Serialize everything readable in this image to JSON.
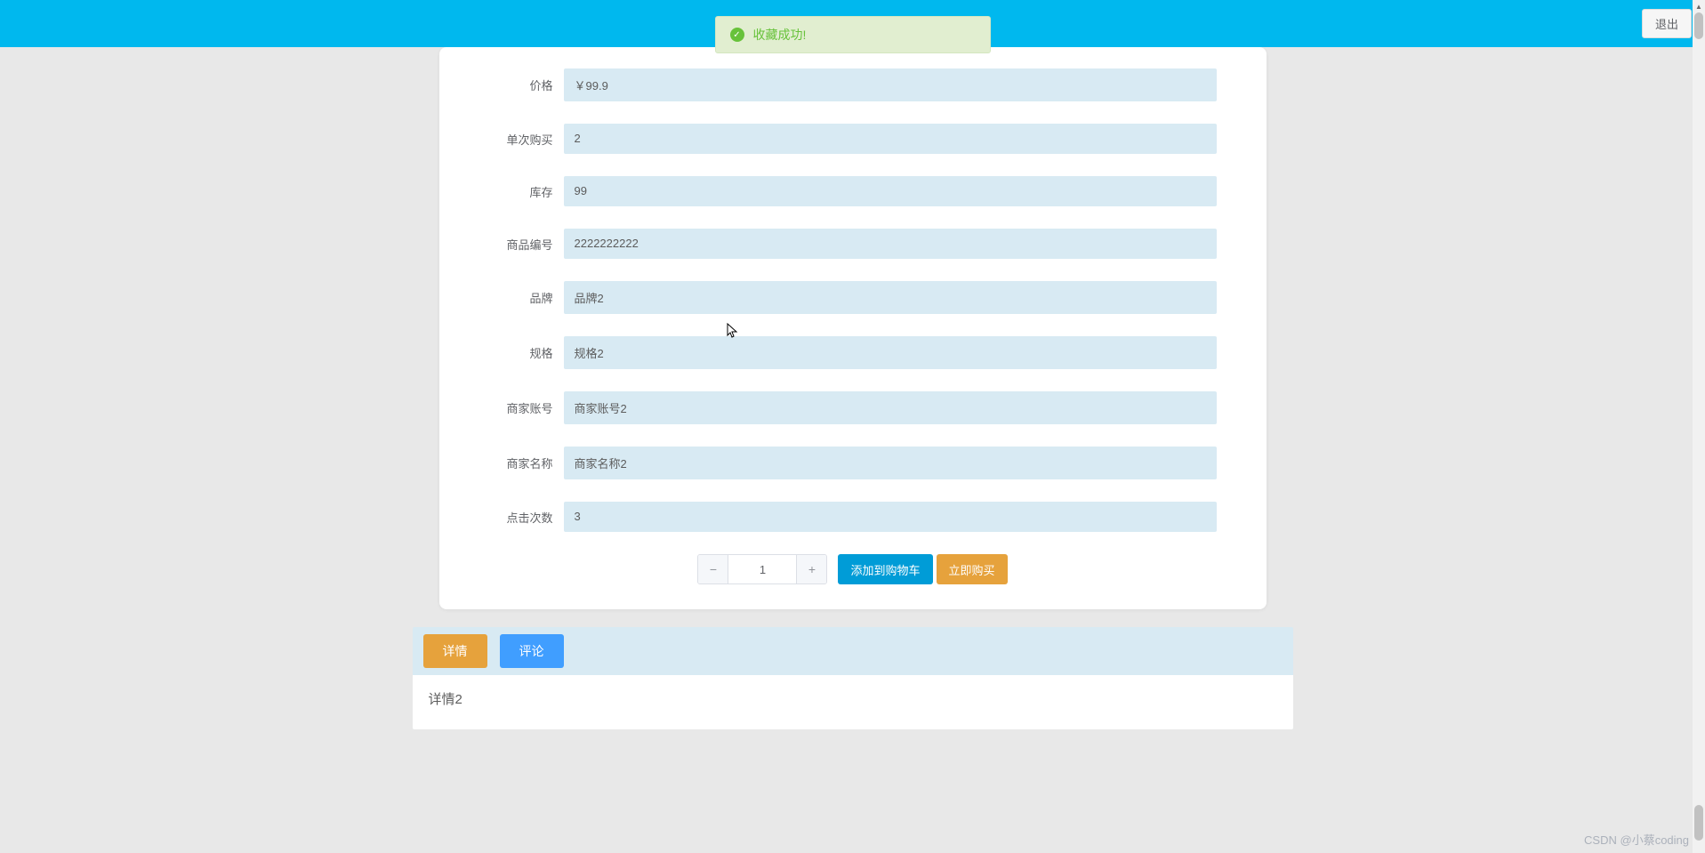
{
  "header": {
    "logout_label": "退出"
  },
  "toast": {
    "message": "收藏成功!"
  },
  "form": {
    "price_label": "价格",
    "price_value": "￥99.9",
    "single_buy_label": "单次购买",
    "single_buy_value": "2",
    "stock_label": "库存",
    "stock_value": "99",
    "product_no_label": "商品编号",
    "product_no_value": "2222222222",
    "brand_label": "品牌",
    "brand_value": "品牌2",
    "spec_label": "规格",
    "spec_value": "规格2",
    "merchant_account_label": "商家账号",
    "merchant_account_value": "商家账号2",
    "merchant_name_label": "商家名称",
    "merchant_name_value": "商家名称2",
    "click_count_label": "点击次数",
    "click_count_value": "3"
  },
  "actions": {
    "quantity_value": "1",
    "add_to_cart_label": "添加到购物车",
    "buy_now_label": "立即购买"
  },
  "tabs": {
    "detail_label": "详情",
    "comment_label": "评论",
    "detail_content": "详情2"
  },
  "watermark": "CSDN @小蔡coding"
}
